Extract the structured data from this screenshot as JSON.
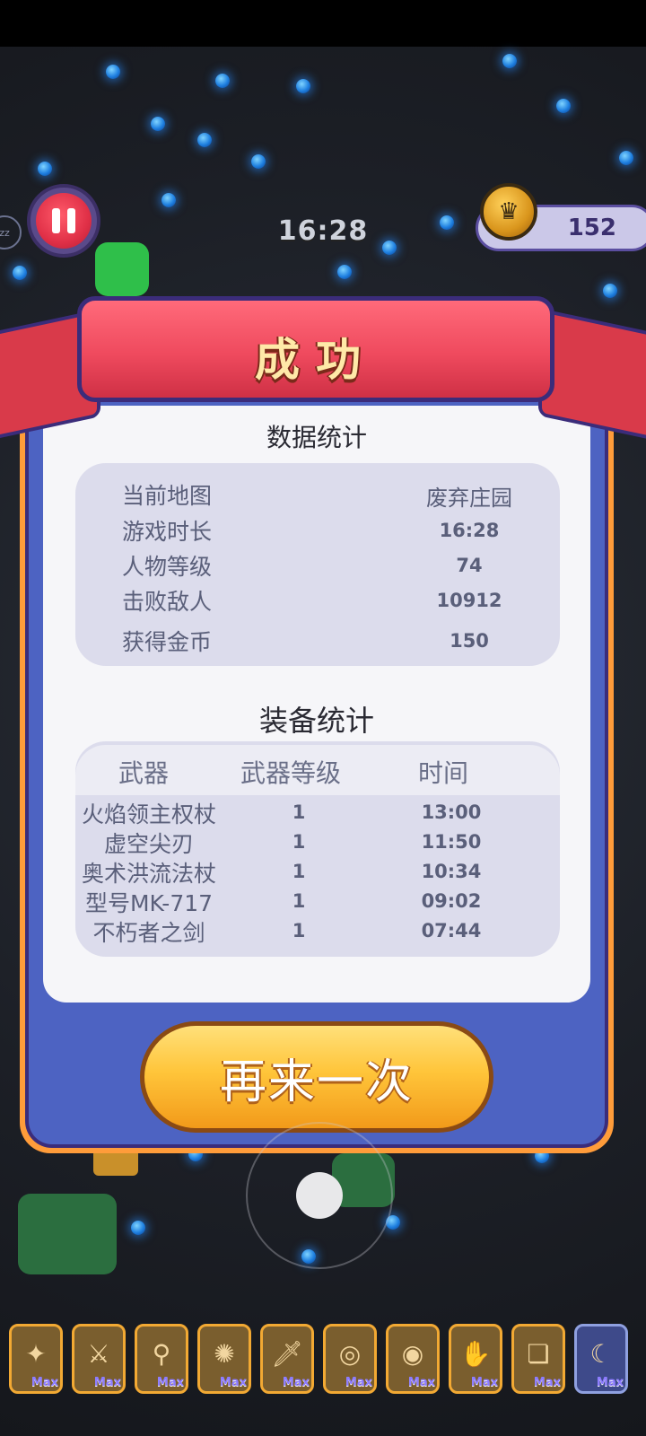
{
  "hud": {
    "timer": "16:28",
    "coins": "152",
    "zz_label": "zz"
  },
  "result": {
    "title": "成功",
    "stats_title": "数据统计",
    "stats": [
      {
        "label": "当前地图",
        "value": "废弃庄园"
      },
      {
        "label": "游戏时长",
        "value": "16:28"
      },
      {
        "label": "人物等级",
        "value": "74"
      },
      {
        "label": "击败敌人",
        "value": "10912"
      },
      {
        "label": "获得金币",
        "value": "150"
      }
    ],
    "equip_title": "装备统计",
    "equip_headers": {
      "weapon": "武器",
      "level": "武器等级",
      "time": "时间"
    },
    "equip_rows": [
      {
        "name": "火焰领主权杖",
        "level": "1",
        "time": "13:00"
      },
      {
        "name": "虚空尖刃",
        "level": "1",
        "time": "11:50"
      },
      {
        "name": "奥术洪流法杖",
        "level": "1",
        "time": "10:34"
      },
      {
        "name": "型号MK-717",
        "level": "1",
        "time": "09:02"
      },
      {
        "name": "不朽者之剑",
        "level": "1",
        "time": "07:44"
      }
    ],
    "retry_label": "再来一次"
  },
  "inventory": {
    "max_label": "Max",
    "slots": [
      {
        "icon": "scepter-icon",
        "glyph": "✦"
      },
      {
        "icon": "blade-icon",
        "glyph": "⚔"
      },
      {
        "icon": "staff-icon",
        "glyph": "⚲"
      },
      {
        "icon": "gun-icon",
        "glyph": "✺"
      },
      {
        "icon": "sword-icon",
        "glyph": "🗡"
      },
      {
        "icon": "ring-icon",
        "glyph": "◎"
      },
      {
        "icon": "shield-icon",
        "glyph": "◉"
      },
      {
        "icon": "glove-icon",
        "glyph": "✋"
      },
      {
        "icon": "scroll-icon",
        "glyph": "❏"
      },
      {
        "icon": "claw-icon",
        "glyph": "☾"
      }
    ]
  }
}
